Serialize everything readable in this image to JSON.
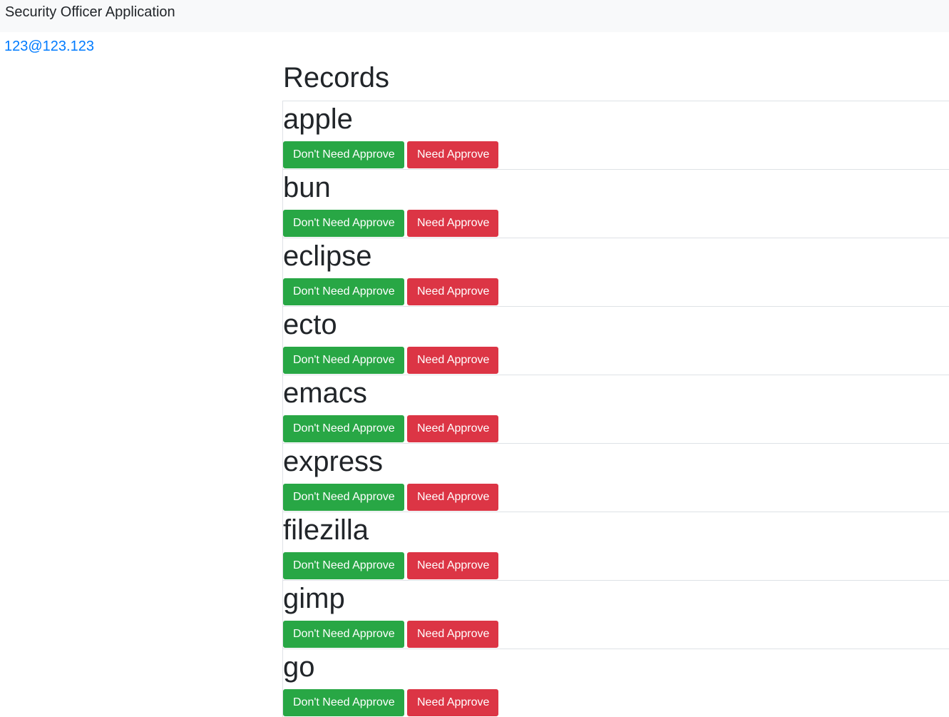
{
  "navbar": {
    "brand": "Security Officer Application"
  },
  "user": {
    "email": "123@123.123"
  },
  "main": {
    "title": "Records",
    "records": [
      {
        "name": "apple"
      },
      {
        "name": "bun"
      },
      {
        "name": "eclipse"
      },
      {
        "name": "ecto"
      },
      {
        "name": "emacs"
      },
      {
        "name": "express"
      },
      {
        "name": "filezilla"
      },
      {
        "name": "gimp"
      },
      {
        "name": "go"
      }
    ],
    "labels": {
      "dont_need_approve": "Don't Need Approve",
      "need_approve": "Need Approve"
    }
  },
  "colors": {
    "success": "#28a745",
    "danger": "#dc3545",
    "link": "#007bff",
    "navbar_bg": "#f8f9fa"
  }
}
